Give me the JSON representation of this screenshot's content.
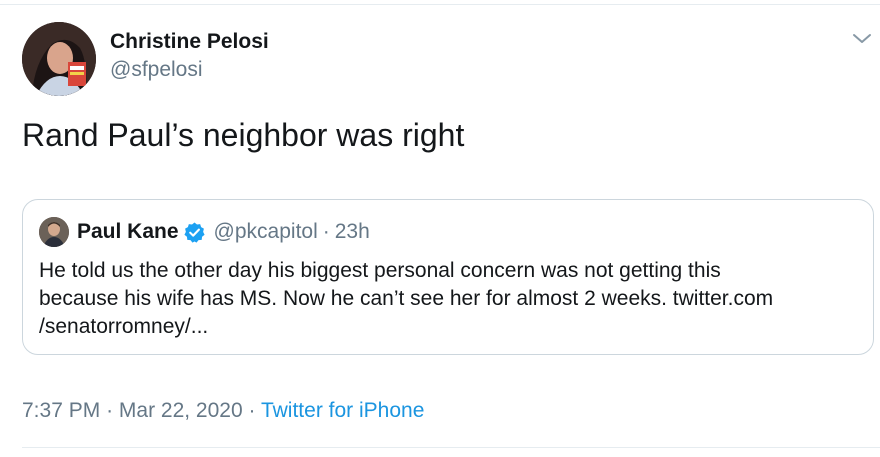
{
  "tweet": {
    "author": {
      "display_name": "Christine Pelosi",
      "handle": "@sfpelosi",
      "avatar": "profile-photo-christine-pelosi"
    },
    "text": "Rand Paul’s neighbor was right",
    "menu_icon": "chevron-down-icon"
  },
  "quote": {
    "author": {
      "display_name": "Paul Kane",
      "handle": "@pkcapitol",
      "verified": true,
      "separator": "·",
      "time": "23h",
      "avatar": "profile-photo-paul-kane"
    },
    "text_lines": [
      "He told us the other day his biggest personal concern was not getting this",
      "because his wife has MS. Now he can’t see her for almost 2 weeks. twitter.com",
      "/senatorromney/..."
    ]
  },
  "meta": {
    "time": "7:37 PM",
    "separator": "·",
    "date": "Mar 22, 2020",
    "source": "Twitter for iPhone"
  },
  "colors": {
    "text": "#14171a",
    "secondary": "#657786",
    "link": "#1b95e0",
    "border": "#ccd6dd",
    "verified": "#1da1f2"
  }
}
